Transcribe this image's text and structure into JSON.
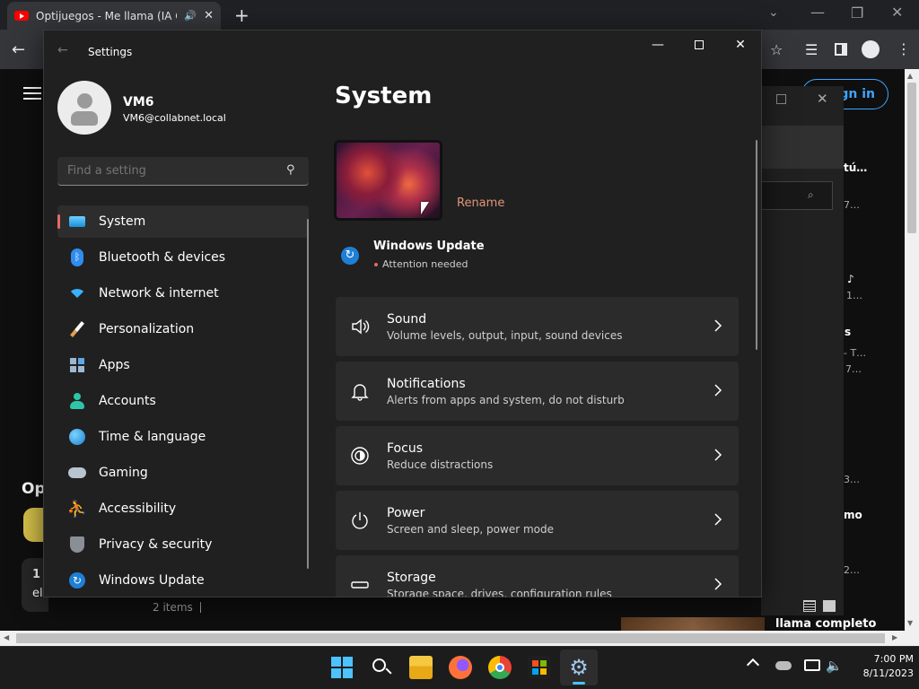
{
  "browser": {
    "tab_title": "Optijuegos - Me llama (IA Co",
    "sign_in_label": "Sign in",
    "partial_left_heading": "Op",
    "partial_left_line1": "1",
    "partial_left_line2": "el",
    "partial_right_labels": [
      "tú…",
      "7…",
      "1…",
      "s",
      "- T…",
      "7…",
      "3…",
      "mo",
      "2…"
    ],
    "video_title_partial": "llama completo",
    "status_items": "2 items"
  },
  "settings": {
    "window_title": "Settings",
    "user": {
      "name": "VM6",
      "email": "VM6@collabnet.local"
    },
    "search": {
      "placeholder": "Find a setting"
    },
    "nav": [
      {
        "label": "System",
        "icon": "monitor-icon",
        "selected": true
      },
      {
        "label": "Bluetooth & devices",
        "icon": "bluetooth-icon"
      },
      {
        "label": "Network & internet",
        "icon": "wifi-icon"
      },
      {
        "label": "Personalization",
        "icon": "brush-icon"
      },
      {
        "label": "Apps",
        "icon": "apps-icon"
      },
      {
        "label": "Accounts",
        "icon": "person-icon"
      },
      {
        "label": "Time & language",
        "icon": "globe-clock-icon"
      },
      {
        "label": "Gaming",
        "icon": "gamepad-icon"
      },
      {
        "label": "Accessibility",
        "icon": "accessibility-icon"
      },
      {
        "label": "Privacy & security",
        "icon": "shield-icon"
      },
      {
        "label": "Windows Update",
        "icon": "sync-icon"
      }
    ],
    "main": {
      "page_title": "System",
      "rename_label": "Rename",
      "update": {
        "title": "Windows Update",
        "status": "Attention needed"
      },
      "cards": [
        {
          "title": "Sound",
          "subtitle": "Volume levels, output, input, sound devices",
          "icon": "speaker-icon"
        },
        {
          "title": "Notifications",
          "subtitle": "Alerts from apps and system, do not disturb",
          "icon": "bell-icon"
        },
        {
          "title": "Focus",
          "subtitle": "Reduce distractions",
          "icon": "focus-icon"
        },
        {
          "title": "Power",
          "subtitle": "Screen and sleep, power mode",
          "icon": "power-icon"
        },
        {
          "title": "Storage",
          "subtitle": "Storage space, drives, configuration rules",
          "icon": "storage-icon"
        }
      ]
    }
  },
  "taskbar": {
    "time": "7:00 PM",
    "date": "8/11/2023"
  },
  "colors": {
    "accent": "#e26a6a",
    "win_blue": "#4cc2ff",
    "rename": "#e0967a"
  }
}
